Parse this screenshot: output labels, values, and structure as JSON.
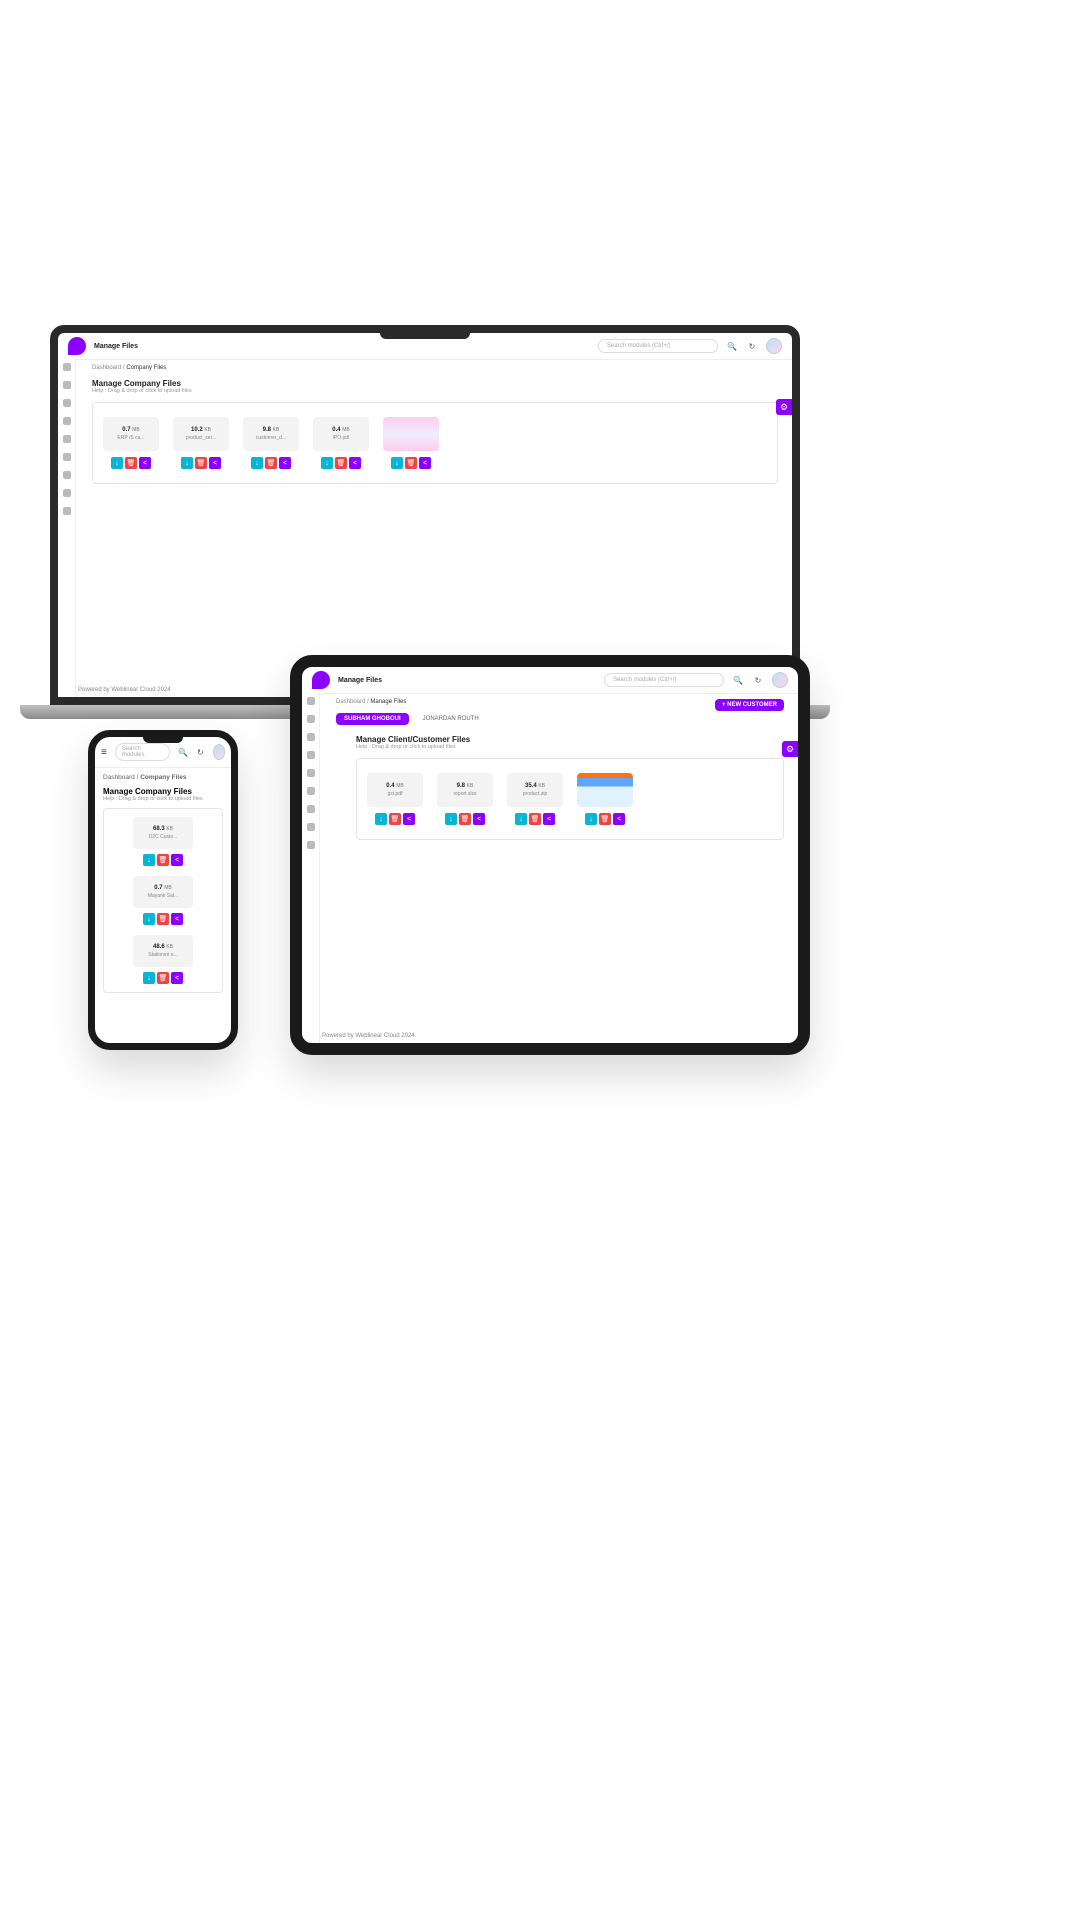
{
  "common": {
    "search_placeholder": "Search modules (Ctrl+/)",
    "footer": "Powered by Weblinear Cloud 2024",
    "breadcrumb_root": "Dashboard",
    "breadcrumb_sep": " / ",
    "help_text": "Help : Drag & drop or click to upload files"
  },
  "laptop": {
    "page_title": "Manage Files",
    "breadcrumb_end": "Company Files",
    "section_title": "Manage Company Files",
    "files": [
      {
        "size": "0.7",
        "unit": "MB",
        "name": "ERP /S ca..."
      },
      {
        "size": "10.2",
        "unit": "KB",
        "name": "product_ser..."
      },
      {
        "size": "9.8",
        "unit": "KB",
        "name": "customer_d..."
      },
      {
        "size": "0.4",
        "unit": "MB",
        "name": "IPO.pdf"
      },
      {
        "image": true
      }
    ]
  },
  "tablet": {
    "page_title": "Manage Files",
    "breadcrumb_end": "Manage Files",
    "tabs": [
      "SUBHAM GHOBOUI",
      "JONARDAN ROUTH"
    ],
    "new_customer": "+ NEW CUSTOMER",
    "section_title": "Manage Client/Customer Files",
    "files": [
      {
        "size": "0.4",
        "unit": "MB",
        "name": "gst.pdf"
      },
      {
        "size": "9.8",
        "unit": "KB",
        "name": "report.xlsx"
      },
      {
        "size": "35.4",
        "unit": "KB",
        "name": "product.zip"
      },
      {
        "image": true
      }
    ]
  },
  "phone": {
    "breadcrumb_end": "Company Files",
    "section_title": "Manage Company Files",
    "files": [
      {
        "size": "68.3",
        "unit": "KB",
        "name": "D2C Custo..."
      },
      {
        "size": "0.7",
        "unit": "MB",
        "name": "Mayank Sal..."
      },
      {
        "size": "48.6",
        "unit": "KB",
        "name": "Stationeri e..."
      }
    ]
  }
}
